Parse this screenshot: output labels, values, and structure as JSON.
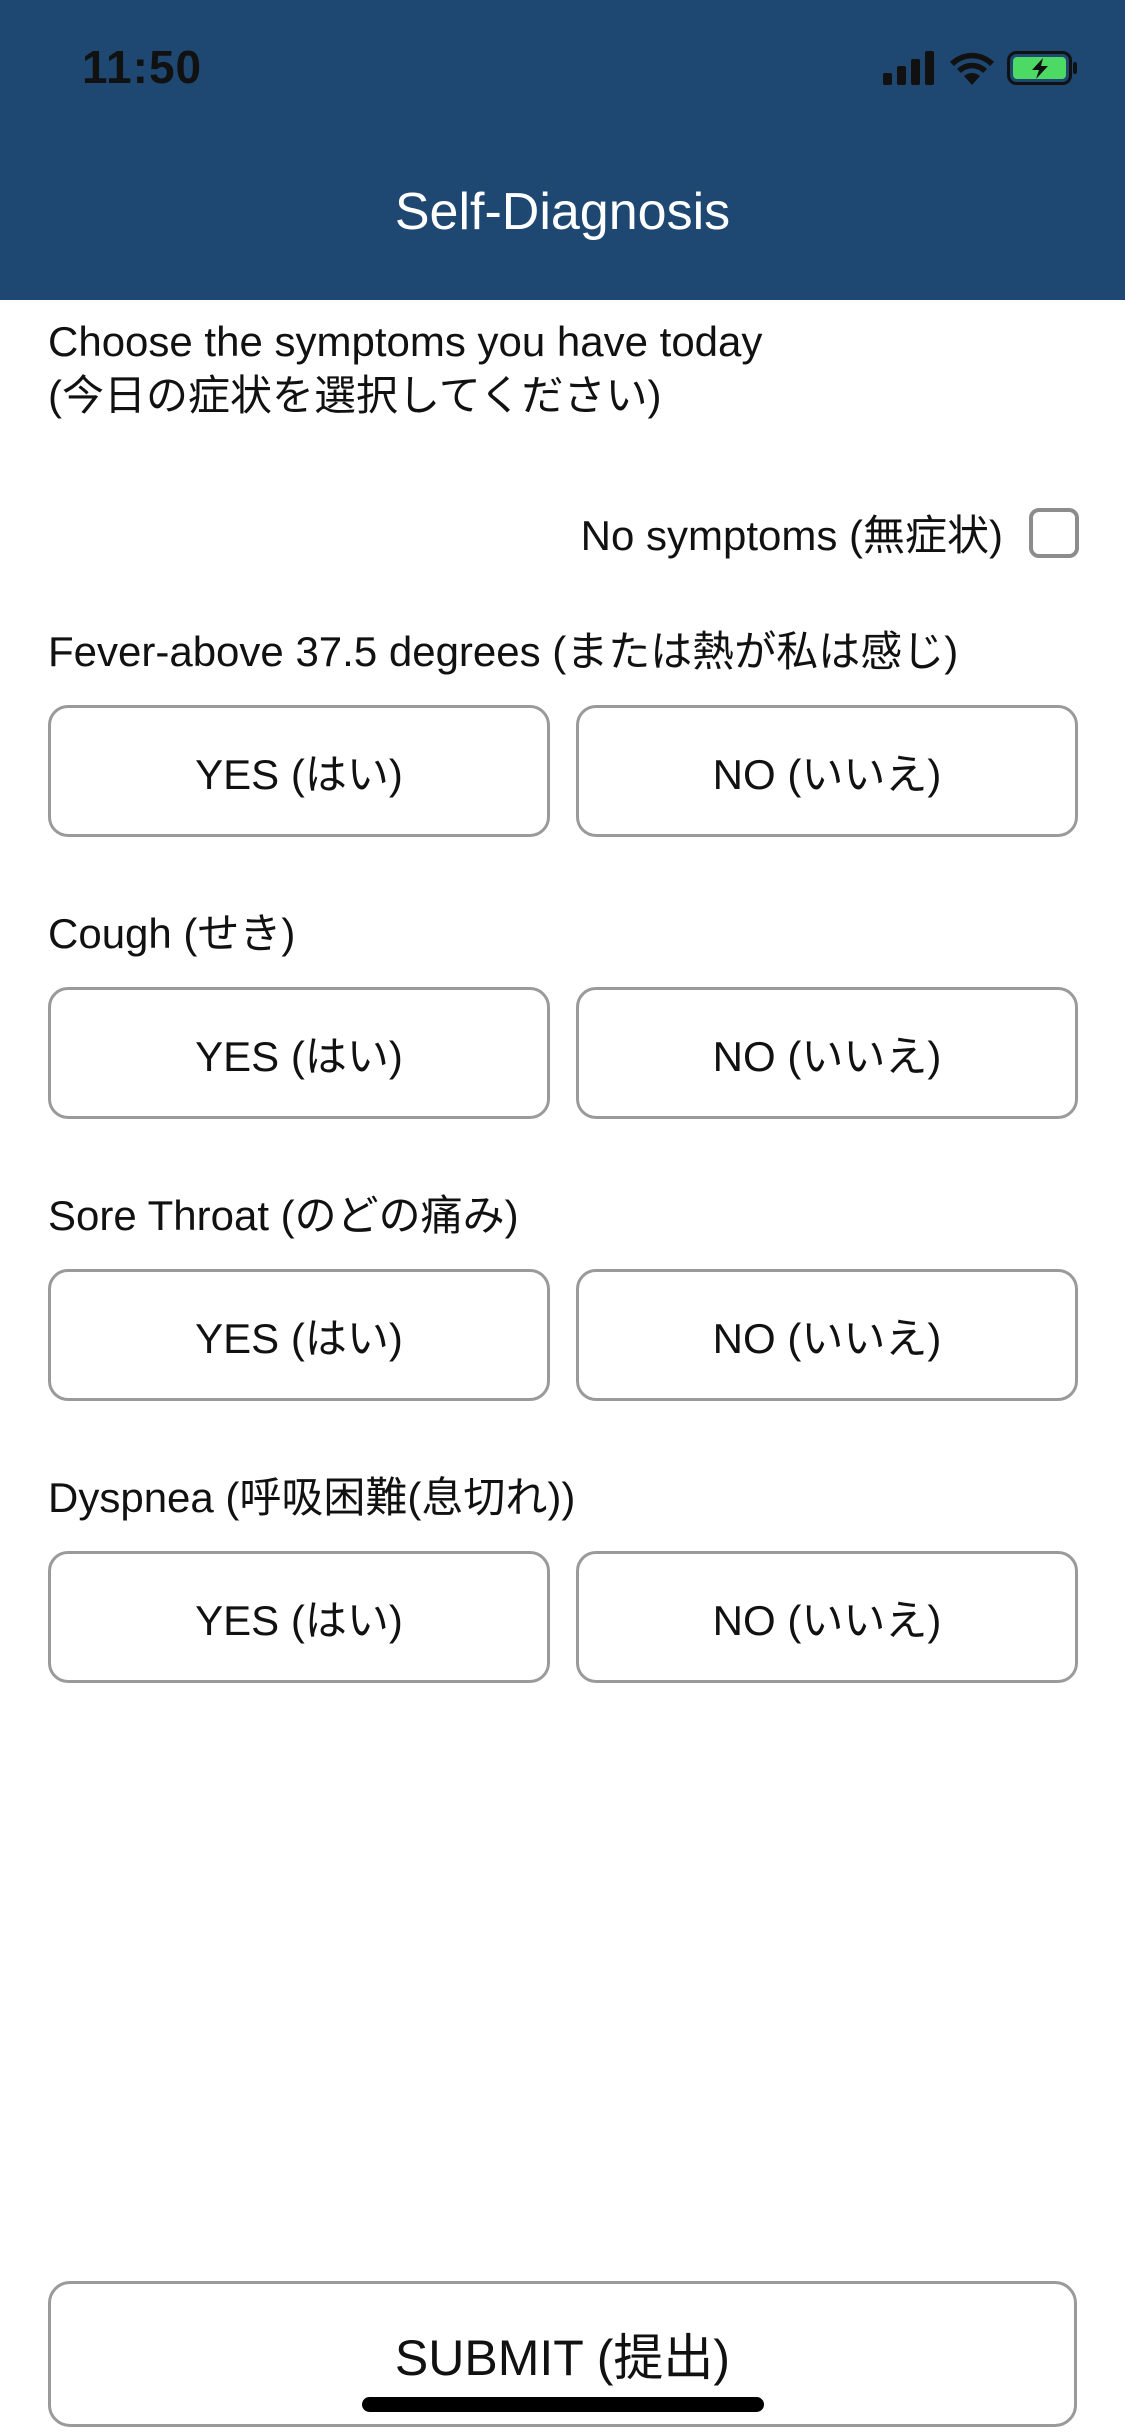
{
  "status_bar": {
    "time": "11:50",
    "icons": [
      "signal-icon",
      "wifi-icon",
      "battery-charging-icon"
    ],
    "battery_color": "#4cd964"
  },
  "nav": {
    "title": "Self-Diagnosis",
    "background": "#1e4872"
  },
  "prompt": {
    "line1": "Choose the symptoms you have today",
    "line2": "(今日の症状を選択してください)"
  },
  "no_symptoms": {
    "label": "No symptoms (無症状)",
    "checked": false
  },
  "questions": [
    {
      "label": "Fever-above 37.5 degrees (または熱が私は感じ)",
      "yes": "YES (はい)",
      "no": "NO (いいえ)"
    },
    {
      "label": "Cough (せき)",
      "yes": "YES (はい)",
      "no": "NO (いいえ)"
    },
    {
      "label": "Sore Throat (のどの痛み)",
      "yes": "YES (はい)",
      "no": "NO (いいえ)"
    },
    {
      "label": "Dyspnea (呼吸困難(息切れ))",
      "yes": "YES (はい)",
      "no": "NO (いいえ)"
    }
  ],
  "submit": {
    "label": "SUBMIT (提出)"
  }
}
